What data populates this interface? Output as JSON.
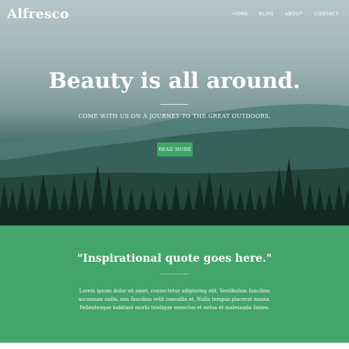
{
  "brand": {
    "name": "Alfresco"
  },
  "nav": {
    "items": [
      {
        "label": "HOME"
      },
      {
        "label": "BLOG"
      },
      {
        "label": "ABOUT"
      },
      {
        "label": "CONTACT"
      }
    ]
  },
  "hero": {
    "title": "Beauty is all around.",
    "subtitle": "COME WITH US ON A JOURNEY TO THE GREAT OUTDOORS.",
    "button_label": "READ MORE"
  },
  "quote_section": {
    "quote": "\"Inspirational quote goes here.\"",
    "body": "Lorem ipsum dolor sit amet, consectetur adipiscing elit. Vestibulum faucibus accumsan nulla, non faucibus velit convallis et. Nulla tempus placerat massa. Pellentesque habitant morbi tristique senectus et netus et malesuada fames."
  },
  "colors": {
    "accent_green": "#43a569",
    "button_green": "#3fa66a",
    "text_white": "#ffffff"
  }
}
